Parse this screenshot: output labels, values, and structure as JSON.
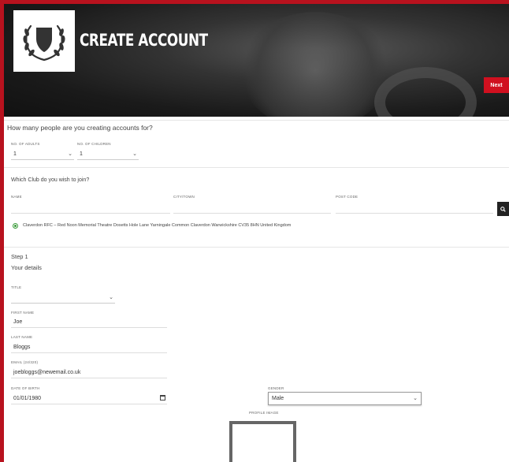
{
  "header": {
    "title": "CREATE ACCOUNT",
    "next_label": "Next"
  },
  "accounts": {
    "question": "How many people are you creating accounts for?",
    "adults_label": "NO. OF ADULTS",
    "adults_value": "1",
    "children_label": "NO. OF CHILDREN",
    "children_value": "1"
  },
  "club": {
    "question": "Which Club do you wish to join?",
    "name_label": "NAME",
    "city_label": "CITY/TOWN",
    "postcode_label": "POST CODE",
    "result": "Claverdon RFC – Red Noon Memorial Theatre Dosetts Hole Lane Yarningale Common Claverdon Warwickshire CV35 8HN United Kingdom"
  },
  "step": {
    "label": "Step 1",
    "subtitle": "Your details"
  },
  "details": {
    "title_label": "TITLE",
    "first_name_label": "FIRST NAME",
    "first_name_value": "Joe",
    "last_name_label": "LAST NAME",
    "last_name_value": "Bloggs",
    "email_label": "EMAIL (24/320)",
    "email_value": "joebloggs@newemail.co.uk",
    "dob_label": "DATE OF BIRTH",
    "dob_value": "01/01/1980",
    "gender_label": "GENDER",
    "gender_value": "Male",
    "profile_label": "PROFILE IMAGE"
  },
  "icons": {
    "logo": "laurel-shield-icon",
    "search": "search-icon",
    "calendar": "calendar-icon",
    "chevron": "chevron-down-icon"
  },
  "colors": {
    "brand_red": "#d0101f",
    "border_red": "#b8121e",
    "radio_green": "#3a9b3a"
  }
}
